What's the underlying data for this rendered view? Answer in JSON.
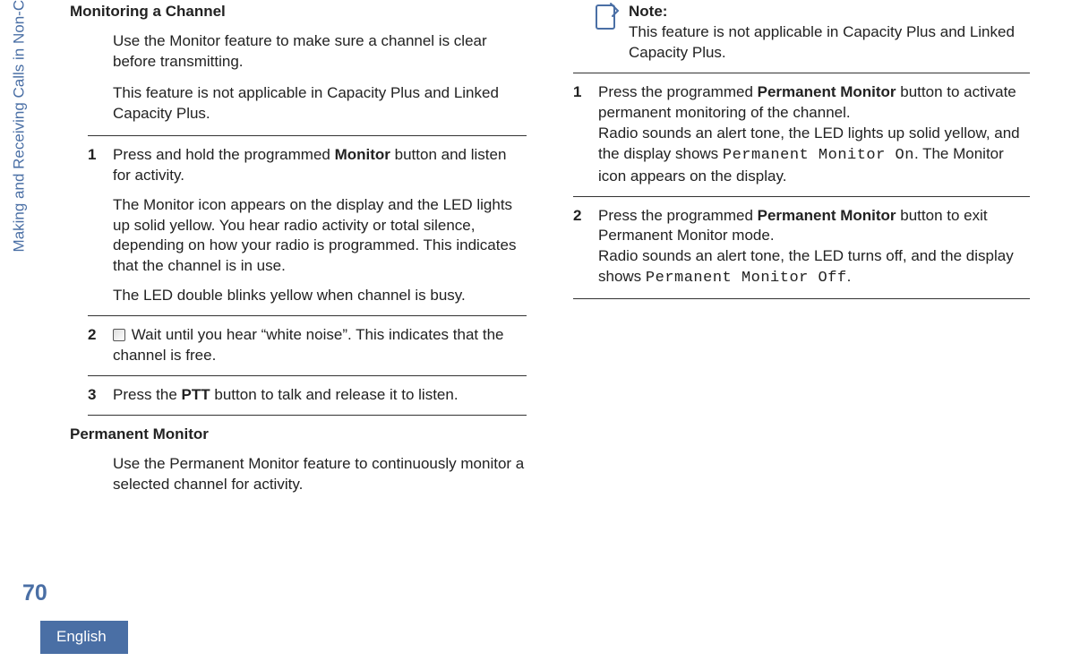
{
  "meta": {
    "chapter": "Making and Receiving Calls in Non-Connect Plus Mode",
    "page": "70",
    "language": "English"
  },
  "col1": {
    "title1": "Monitoring a Channel",
    "intro1a": "Use the Monitor feature to make sure a channel is clear before transmitting.",
    "intro1b": "This feature is not applicable in Capacity Plus and Linked Capacity Plus.",
    "s1": {
      "num": "1",
      "p1a": "Press and hold the programmed ",
      "p1b": "Monitor",
      "p1c": " button and listen for activity.",
      "p2": "The Monitor icon appears on the display and the LED lights up solid yellow. You hear radio activity or total silence, depending on how your radio is programmed. This indicates that the channel is in use.",
      "p3": "The LED double blinks yellow when channel is busy."
    },
    "s2": {
      "num": "2",
      "p1": " Wait until you hear “white noise”. This indicates that the channel is free."
    },
    "s3": {
      "num": "3",
      "p1a": "Press the ",
      "p1b": "PTT",
      "p1c": " button to talk and release it to listen."
    },
    "title2": "Permanent Monitor",
    "intro2": "Use the Permanent Monitor feature to continuously monitor a selected channel for activity."
  },
  "col2": {
    "note": {
      "label": "Note:",
      "body": "This feature is not applicable in Capacity Plus and Linked Capacity Plus."
    },
    "s1": {
      "num": "1",
      "p1a": "Press the programmed ",
      "p1b": "Permanent Monitor",
      "p1c": " button to activate permanent monitoring of the channel.",
      "p2a": "Radio sounds an alert tone, the LED lights up solid yellow, and the display shows ",
      "p2b": "Permanent Monitor On",
      "p2c": ". The Monitor icon appears on the display."
    },
    "s2": {
      "num": "2",
      "p1a": "Press the programmed ",
      "p1b": "Permanent Monitor",
      "p1c": " button to exit Permanent Monitor mode.",
      "p2a": "Radio sounds an alert tone, the LED turns off, and the display shows ",
      "p2b": "Permanent Monitor Off",
      "p2c": "."
    }
  }
}
